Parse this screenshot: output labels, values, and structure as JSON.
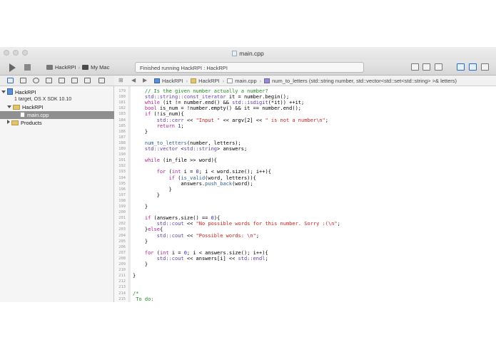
{
  "window": {
    "title": "main.cpp",
    "scheme": "HackRPI",
    "destination": "My Mac",
    "status": "Finished running HackRPI : HackRPI"
  },
  "navigator": {
    "project": "HackRPI",
    "project_sub": "1 target, OS X SDK 10.10",
    "group": "HackRPI",
    "file": "main.cpp",
    "products": "Products"
  },
  "jumpbar": {
    "crumbs": [
      "HackRPI",
      "HackRPI",
      "main.cpp",
      "num_to_letters (std::string number, std::vector<std::set<std::string> >& letters)"
    ]
  },
  "editor": {
    "line_numbers": [
      "179",
      "180",
      "181",
      "182",
      "183",
      "184",
      "185",
      "186",
      "187",
      "188",
      "189",
      "190",
      "191",
      "192",
      "193",
      "194",
      "195",
      "196",
      "197",
      "198",
      "199",
      "200",
      "201",
      "202",
      "203",
      "204",
      "205",
      "206",
      "207",
      "208",
      "209",
      "210",
      "211",
      "212",
      "213",
      "214",
      "215"
    ],
    "lines": [
      "    // Is the given number actually a number?",
      "    std::string::const_iterator it = number.begin();",
      "    while (it != number.end() && std::isdigit(*it)) ++it;",
      "    bool is_num = !number.empty() && it == number.end();",
      "    if (!is_num){",
      "        std::cerr << \"Input \" << argv[2] << \" is not a number\\n\";",
      "        return 1;",
      "    }",
      "",
      "    num_to_letters(number, letters);",
      "    std::vector <std::string> answers;",
      "",
      "    while (in_file >> word){",
      "",
      "        for (int i = 0; i < word.size(); i++){",
      "            if (is_valid(word, letters)){",
      "                answers.push_back(word);",
      "            }",
      "        }",
      "",
      "    }",
      "",
      "    if (answers.size() == 0){",
      "        std::cout << \"No possible words for this number. Sorry :(\\n\";",
      "    }else{",
      "        std::cout << \"Possible words: \\n\";",
      "    }",
      "",
      "    for (int i = 0; i < answers.size(); i++){",
      "        std::cout << answers[i] << std::endl;",
      "    }",
      "",
      "}",
      "",
      "",
      "/*",
      " To do:"
    ]
  }
}
